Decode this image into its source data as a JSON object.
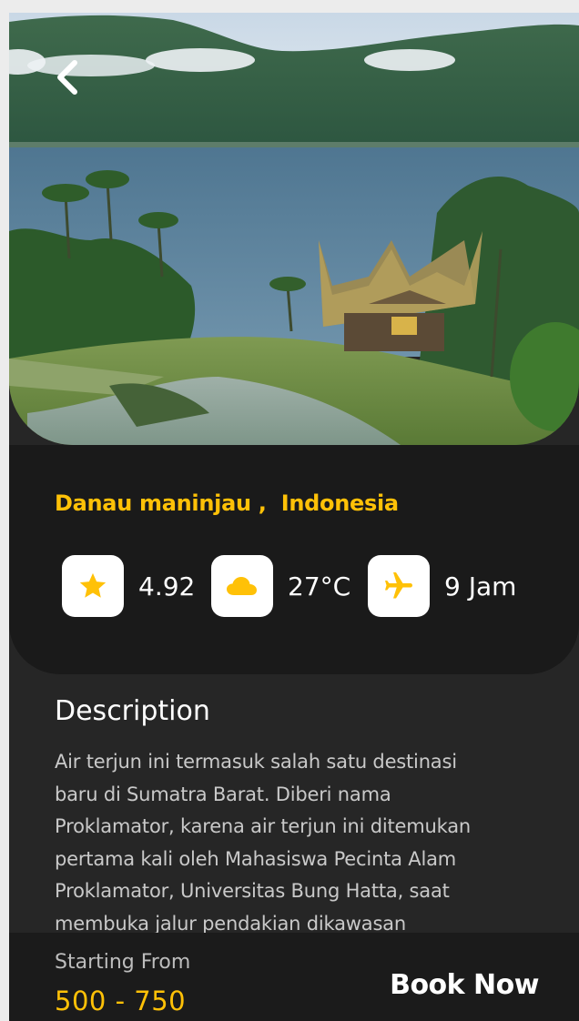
{
  "hero": {
    "image_alt": "Danau Maninjau lake view with rumah gadang"
  },
  "location": {
    "name": "Danau maninjau ,",
    "country": "Indonesia"
  },
  "stats": [
    {
      "icon": "star-icon",
      "value": "4.92"
    },
    {
      "icon": "cloud-icon",
      "value": "27°C"
    },
    {
      "icon": "airplane-icon",
      "value": "9 Jam"
    }
  ],
  "description": {
    "title": "Description",
    "lines": [
      "Air terjun ini termasuk salah satu destinasi",
      "baru di Sumatra Barat. Diberi nama",
      "Proklamator, karena air terjun ini ditemukan",
      "pertama kali oleh Mahasiswa Pecinta Alam",
      "Proklamator, Universitas Bung Hatta, saat",
      "membuka jalur pendakian dikawasan"
    ]
  },
  "booking": {
    "starting_label": "Starting From",
    "price": "500 - 750",
    "book_label": "Book Now"
  },
  "colors": {
    "accent": "#ffc107",
    "background": "#262626",
    "card": "#1a1a1a"
  }
}
